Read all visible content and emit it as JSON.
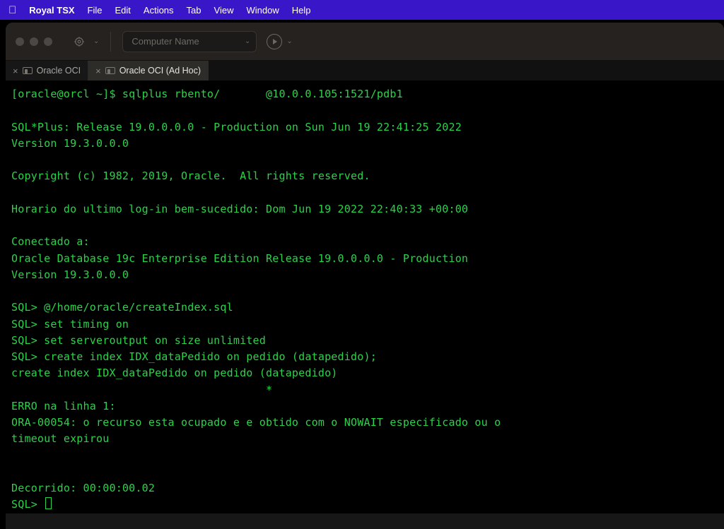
{
  "menubar": {
    "app_name": "Royal TSX",
    "items": [
      "File",
      "Edit",
      "Actions",
      "Tab",
      "View",
      "Window",
      "Help"
    ]
  },
  "toolbar": {
    "computer_select_label": "Computer Name"
  },
  "tabs": [
    {
      "label": "Oracle OCI",
      "active": false
    },
    {
      "label": "Oracle OCI (Ad Hoc)",
      "active": true
    }
  ],
  "terminal": {
    "lines": [
      "[oracle@orcl ~]$ sqlplus rbento/       @10.0.0.105:1521/pdb1",
      "",
      "SQL*Plus: Release 19.0.0.0.0 - Production on Sun Jun 19 22:41:25 2022",
      "Version 19.3.0.0.0",
      "",
      "Copyright (c) 1982, 2019, Oracle.  All rights reserved.",
      "",
      "Horario do ultimo log-in bem-sucedido: Dom Jun 19 2022 22:40:33 +00:00",
      "",
      "Conectado a:",
      "Oracle Database 19c Enterprise Edition Release 19.0.0.0.0 - Production",
      "Version 19.3.0.0.0",
      "",
      "SQL> @/home/oracle/createIndex.sql",
      "SQL> set timing on",
      "SQL> set serveroutput on size unlimited",
      "SQL> create index IDX_dataPedido on pedido (datapedido);",
      "create index IDX_dataPedido on pedido (datapedido)",
      "                                       *",
      "ERRO na linha 1:",
      "ORA-00054: o recurso esta ocupado e e obtido com o NOWAIT especificado ou o",
      "timeout expirou",
      "",
      "",
      "Decorrido: 00:00:00.02"
    ],
    "prompt": "SQL> "
  }
}
